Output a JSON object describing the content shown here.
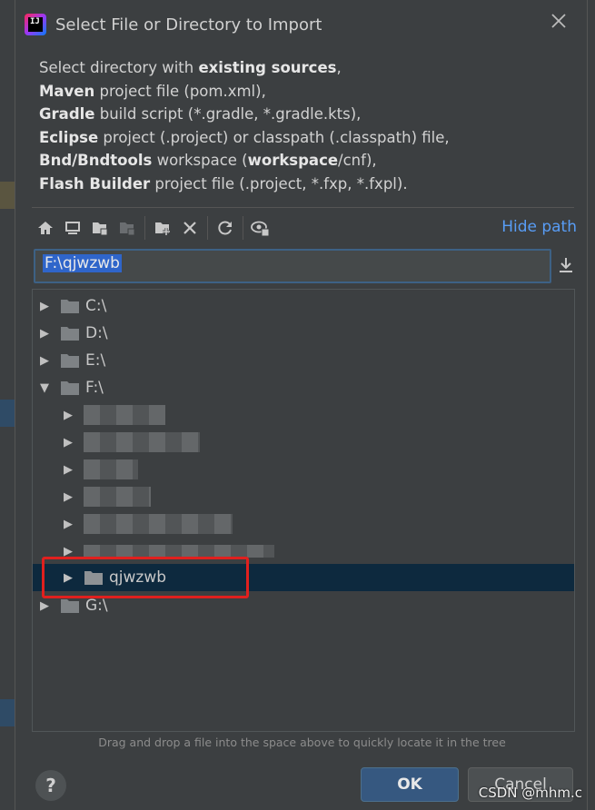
{
  "dialog": {
    "title": "Select File or Directory to Import",
    "logo_text": "IJ"
  },
  "description": {
    "line1_pre": "Select directory with ",
    "line1_bold": "existing sources",
    "line1_post": ",",
    "line2_bold": "Maven",
    "line2_post": " project file (pom.xml),",
    "line3_bold": "Gradle",
    "line3_post": " build script (*.gradle, *.gradle.kts),",
    "line4_bold": "Eclipse",
    "line4_post": " project (.project) or classpath (.classpath) file,",
    "line5_bold": "Bnd/Bndtools",
    "line5_mid": " workspace (",
    "line5_bold2": "workspace",
    "line5_post": "/cnf),",
    "line6_bold": "Flash Builder",
    "line6_post": " project file (.project, *.fxp, *.fxpl)."
  },
  "toolbar": {
    "hide_path": "Hide path",
    "icons": [
      "home-icon",
      "desktop-icon",
      "project-folder-icon",
      "module-folder-icon",
      "new-folder-icon",
      "delete-icon",
      "refresh-icon",
      "show-hidden-icon"
    ]
  },
  "path": {
    "value": "F:\\qjwzwb"
  },
  "tree": {
    "drives": [
      "C:\\",
      "D:\\",
      "E:\\",
      "F:\\",
      "G:\\"
    ],
    "selected_folder": "qjwzwb"
  },
  "hint": "Drag and drop a file into the space above to quickly locate it in the tree",
  "buttons": {
    "help": "?",
    "ok": "OK",
    "cancel": "Cancel"
  },
  "watermark": "CSDN @mhm.c",
  "colors": {
    "accent": "#589df6",
    "selection": "#0d293e",
    "highlight_box": "#e0201e",
    "ok_button": "#365880"
  }
}
